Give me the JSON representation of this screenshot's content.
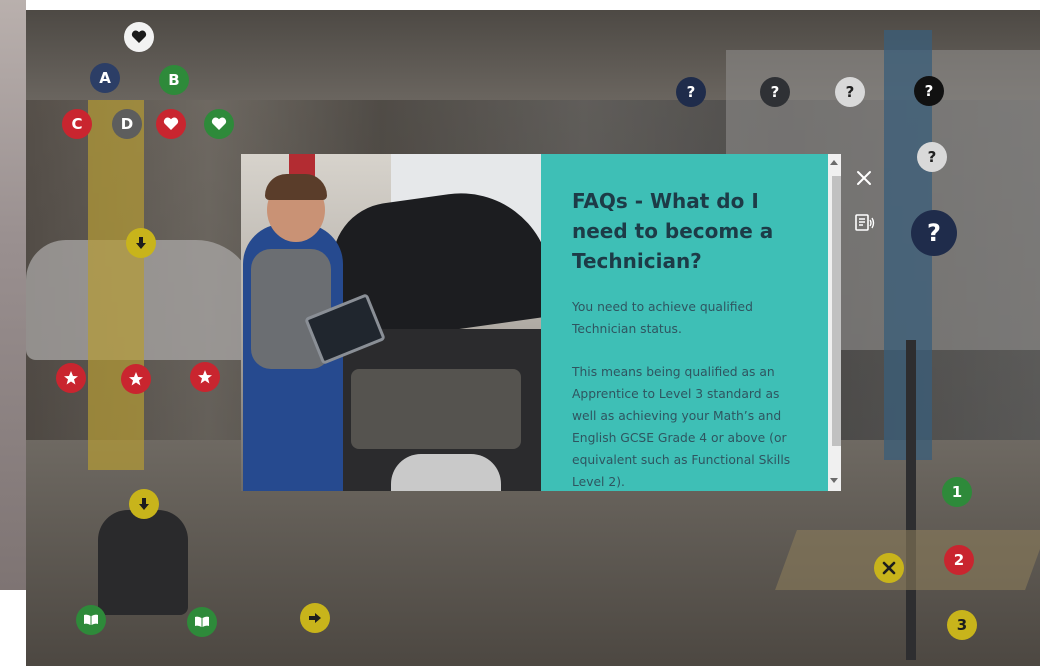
{
  "modal": {
    "title": "FAQs - What do I need to become a Technician?",
    "paragraphs": [
      "You need to achieve qualified Technician status.",
      "This means being qualified as an Apprentice to Level 3 standard as well as achieving your Math’s and English GCSE Grade 4 or above (or equivalent such as Functional Skills Level 2)."
    ],
    "close_icon": "close-icon",
    "audio_icon": "read-aloud-icon",
    "background_color": "#3ebfb6",
    "title_color": "#1d3b47"
  },
  "hotspots": {
    "letters": [
      "A",
      "B",
      "C",
      "D"
    ],
    "numbers": [
      "1",
      "2",
      "3"
    ],
    "question_icon": "question-icon",
    "heart_icon": "heart-icon",
    "star_icon": "star-icon",
    "arrow_down_icon": "arrow-down-icon",
    "arrow_right_icon": "arrow-right-icon",
    "book_icon": "book-icon",
    "cross_icon": "cross-icon"
  },
  "colors": {
    "red": "#c9252f",
    "green": "#2e8a3a",
    "navy": "#2c3e66",
    "yellow": "#c8b41b",
    "gray": "#5d5d5d"
  }
}
